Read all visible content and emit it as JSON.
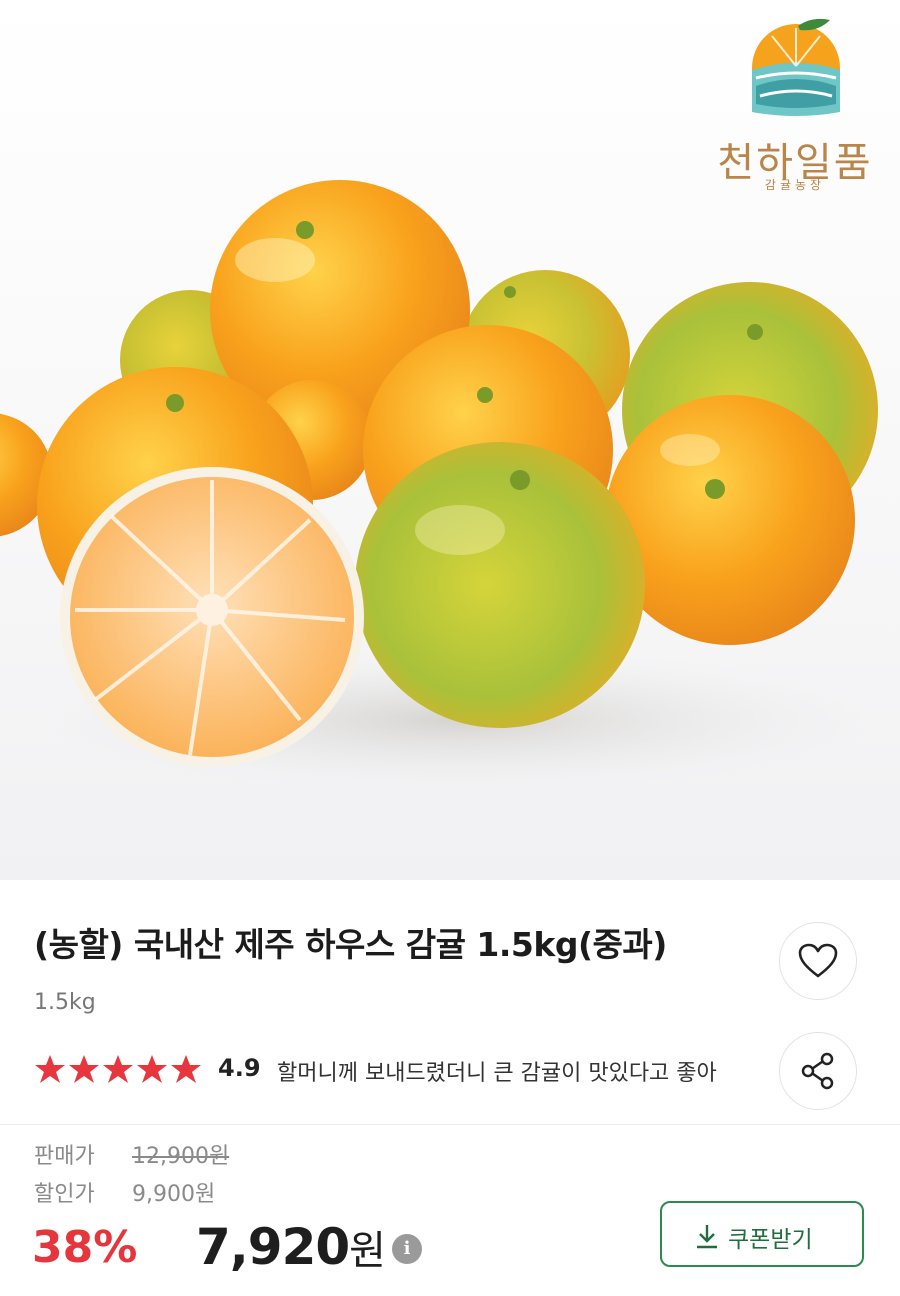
{
  "brand": {
    "name": "천하일품",
    "subtitle": "감귤농장"
  },
  "product": {
    "title": "(농할) 국내산 제주 하우스 감귤 1.5kg(중과)",
    "weight": "1.5kg",
    "rating": "4.9",
    "stars": 5,
    "review_snippet": "할머니께 보내드렸더니 큰 감귤이 맛있다고 좋아"
  },
  "price": {
    "sale_label": "판매가",
    "sale_value": "12,900원",
    "discount_label": "할인가",
    "discount_value": "9,900원",
    "discount_rate": "38%",
    "final_number": "7,920",
    "final_unit": "원"
  },
  "actions": {
    "coupon_label": "쿠폰받기"
  },
  "colors": {
    "discount_red": "#e5353d",
    "star_red": "#e8363f",
    "coupon_green": "#2b8a4f",
    "brand_gold": "#b8864a"
  },
  "icons": [
    "heart-icon",
    "share-icon",
    "info-icon",
    "download-icon",
    "star-icon"
  ]
}
